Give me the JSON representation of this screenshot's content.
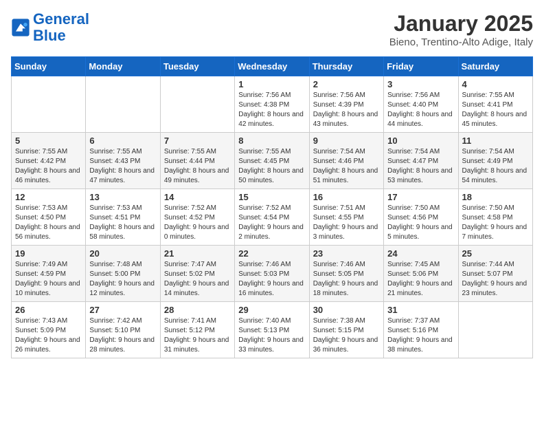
{
  "header": {
    "logo_line1": "General",
    "logo_line2": "Blue",
    "title": "January 2025",
    "subtitle": "Bieno, Trentino-Alto Adige, Italy"
  },
  "weekdays": [
    "Sunday",
    "Monday",
    "Tuesday",
    "Wednesday",
    "Thursday",
    "Friday",
    "Saturday"
  ],
  "weeks": [
    [
      {
        "day": "",
        "info": ""
      },
      {
        "day": "",
        "info": ""
      },
      {
        "day": "",
        "info": ""
      },
      {
        "day": "1",
        "info": "Sunrise: 7:56 AM\nSunset: 4:38 PM\nDaylight: 8 hours and 42 minutes."
      },
      {
        "day": "2",
        "info": "Sunrise: 7:56 AM\nSunset: 4:39 PM\nDaylight: 8 hours and 43 minutes."
      },
      {
        "day": "3",
        "info": "Sunrise: 7:56 AM\nSunset: 4:40 PM\nDaylight: 8 hours and 44 minutes."
      },
      {
        "day": "4",
        "info": "Sunrise: 7:55 AM\nSunset: 4:41 PM\nDaylight: 8 hours and 45 minutes."
      }
    ],
    [
      {
        "day": "5",
        "info": "Sunrise: 7:55 AM\nSunset: 4:42 PM\nDaylight: 8 hours and 46 minutes."
      },
      {
        "day": "6",
        "info": "Sunrise: 7:55 AM\nSunset: 4:43 PM\nDaylight: 8 hours and 47 minutes."
      },
      {
        "day": "7",
        "info": "Sunrise: 7:55 AM\nSunset: 4:44 PM\nDaylight: 8 hours and 49 minutes."
      },
      {
        "day": "8",
        "info": "Sunrise: 7:55 AM\nSunset: 4:45 PM\nDaylight: 8 hours and 50 minutes."
      },
      {
        "day": "9",
        "info": "Sunrise: 7:54 AM\nSunset: 4:46 PM\nDaylight: 8 hours and 51 minutes."
      },
      {
        "day": "10",
        "info": "Sunrise: 7:54 AM\nSunset: 4:47 PM\nDaylight: 8 hours and 53 minutes."
      },
      {
        "day": "11",
        "info": "Sunrise: 7:54 AM\nSunset: 4:49 PM\nDaylight: 8 hours and 54 minutes."
      }
    ],
    [
      {
        "day": "12",
        "info": "Sunrise: 7:53 AM\nSunset: 4:50 PM\nDaylight: 8 hours and 56 minutes."
      },
      {
        "day": "13",
        "info": "Sunrise: 7:53 AM\nSunset: 4:51 PM\nDaylight: 8 hours and 58 minutes."
      },
      {
        "day": "14",
        "info": "Sunrise: 7:52 AM\nSunset: 4:52 PM\nDaylight: 9 hours and 0 minutes."
      },
      {
        "day": "15",
        "info": "Sunrise: 7:52 AM\nSunset: 4:54 PM\nDaylight: 9 hours and 2 minutes."
      },
      {
        "day": "16",
        "info": "Sunrise: 7:51 AM\nSunset: 4:55 PM\nDaylight: 9 hours and 3 minutes."
      },
      {
        "day": "17",
        "info": "Sunrise: 7:50 AM\nSunset: 4:56 PM\nDaylight: 9 hours and 5 minutes."
      },
      {
        "day": "18",
        "info": "Sunrise: 7:50 AM\nSunset: 4:58 PM\nDaylight: 9 hours and 7 minutes."
      }
    ],
    [
      {
        "day": "19",
        "info": "Sunrise: 7:49 AM\nSunset: 4:59 PM\nDaylight: 9 hours and 10 minutes."
      },
      {
        "day": "20",
        "info": "Sunrise: 7:48 AM\nSunset: 5:00 PM\nDaylight: 9 hours and 12 minutes."
      },
      {
        "day": "21",
        "info": "Sunrise: 7:47 AM\nSunset: 5:02 PM\nDaylight: 9 hours and 14 minutes."
      },
      {
        "day": "22",
        "info": "Sunrise: 7:46 AM\nSunset: 5:03 PM\nDaylight: 9 hours and 16 minutes."
      },
      {
        "day": "23",
        "info": "Sunrise: 7:46 AM\nSunset: 5:05 PM\nDaylight: 9 hours and 18 minutes."
      },
      {
        "day": "24",
        "info": "Sunrise: 7:45 AM\nSunset: 5:06 PM\nDaylight: 9 hours and 21 minutes."
      },
      {
        "day": "25",
        "info": "Sunrise: 7:44 AM\nSunset: 5:07 PM\nDaylight: 9 hours and 23 minutes."
      }
    ],
    [
      {
        "day": "26",
        "info": "Sunrise: 7:43 AM\nSunset: 5:09 PM\nDaylight: 9 hours and 26 minutes."
      },
      {
        "day": "27",
        "info": "Sunrise: 7:42 AM\nSunset: 5:10 PM\nDaylight: 9 hours and 28 minutes."
      },
      {
        "day": "28",
        "info": "Sunrise: 7:41 AM\nSunset: 5:12 PM\nDaylight: 9 hours and 31 minutes."
      },
      {
        "day": "29",
        "info": "Sunrise: 7:40 AM\nSunset: 5:13 PM\nDaylight: 9 hours and 33 minutes."
      },
      {
        "day": "30",
        "info": "Sunrise: 7:38 AM\nSunset: 5:15 PM\nDaylight: 9 hours and 36 minutes."
      },
      {
        "day": "31",
        "info": "Sunrise: 7:37 AM\nSunset: 5:16 PM\nDaylight: 9 hours and 38 minutes."
      },
      {
        "day": "",
        "info": ""
      }
    ]
  ]
}
